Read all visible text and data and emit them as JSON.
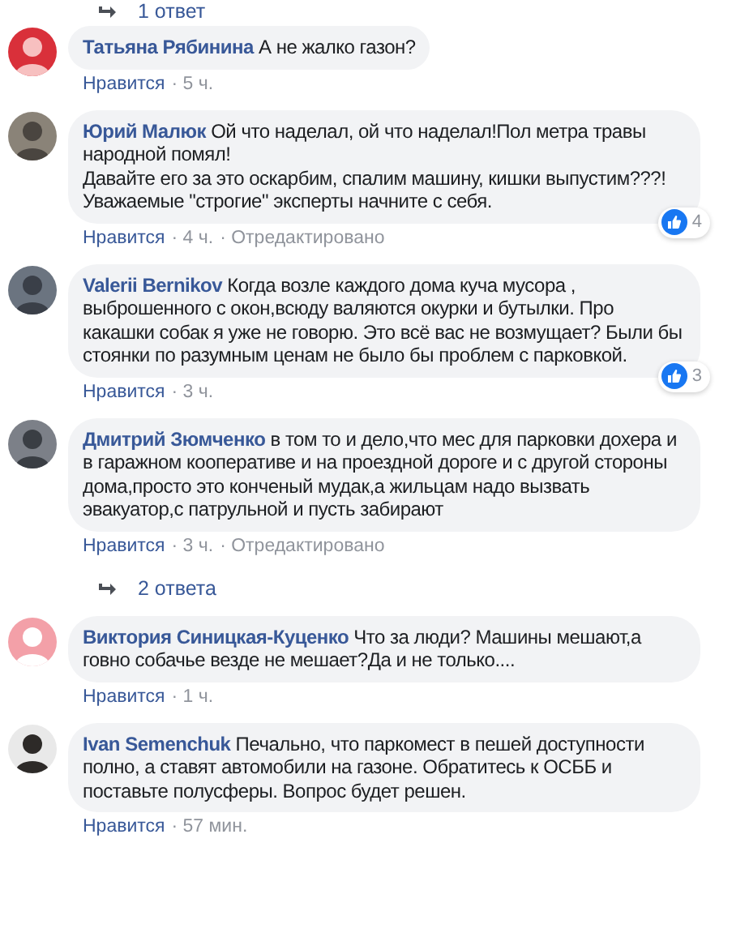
{
  "previous_replies": {
    "label": "1 ответ"
  },
  "comments": [
    {
      "author": "Татьяна Рябинина",
      "text": "А не жалко газон?",
      "like": "Нравится",
      "time": "· 5 ч."
    },
    {
      "author": "Юрий Малюк",
      "text": "Ой что наделал, ой что наделал!Пол метра травы народной помял!\nДавайте его за это оскарбим, спалим машину, кишки выпустим???!\nУважаемые \"строгие\" эксперты начните с себя.",
      "like": "Нравится",
      "time": "· 4 ч.",
      "edited": "· Отредактировано",
      "reactions": "4"
    },
    {
      "author": "Valerii Bernikov",
      "text": "Когда возле каждого дома куча мусора , выброшенного с окон,всюду валяются окурки и бутылки. Про какашки собак я уже не говорю. Это всё вас не возмущает? Были бы стоянки по разумным ценам не было бы проблем с парковкой.",
      "like": "Нравится",
      "time": "· 3 ч.",
      "reactions": "3"
    },
    {
      "author": "Дмитрий Зюмченко",
      "text": "в том то и дело,что мес для парковки дохера и в гаражном кооперативе и на проездной дороге и с другой стороны дома,просто это конченый мудак,а жильцам надо вызвать эвакуатор,с патрульной и пусть забирают",
      "like": "Нравится",
      "time": "· 3 ч.",
      "edited": "· Отредактировано",
      "replies": "2 ответа"
    },
    {
      "author": "Виктория Синицкая-Куценко",
      "text": "Что за люди? Машины мешают,а говно собачье везде не мешает?Да и не только....",
      "like": "Нравится",
      "time": "· 1 ч."
    },
    {
      "author": "Ivan Semenchuk",
      "text": "Печально, что паркомест в пешей доступности полно, а ставят автомобили на газоне. Обратитесь к ОСББ и поставьте полусферы. Вопрос будет решен.",
      "like": "Нравится",
      "time": "· 57 мин."
    }
  ]
}
